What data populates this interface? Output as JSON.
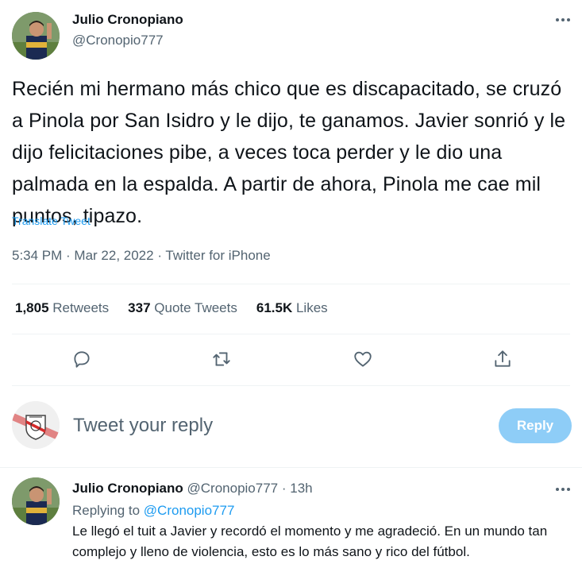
{
  "tweet": {
    "author_name": "Julio Cronopiano",
    "author_handle": "@Cronopio777",
    "text": "Recién mi hermano más chico que es discapacitado, se cruzó a Pinola por San Isidro y le dijo, te ganamos. Javier sonrió y le dijo felicitaciones pibe, a veces toca perder y le dio una palmada en la espalda. A partir de ahora, Pinola me cae mil puntos, tipazo.",
    "translate_label": "Translate Tweet",
    "time": "5:34 PM",
    "date": "Mar 22, 2022",
    "source": "Twitter for iPhone",
    "separator": " · "
  },
  "stats": {
    "retweets_count": "1,805",
    "retweets_label": "Retweets",
    "quotes_count": "337",
    "quotes_label": "Quote Tweets",
    "likes_count": "61.5K",
    "likes_label": "Likes"
  },
  "actions": [
    "reply-icon",
    "retweet-icon",
    "like-icon",
    "share-icon"
  ],
  "composer": {
    "placeholder": "Tweet your reply",
    "button_label": "Reply"
  },
  "reply": {
    "author_name": "Julio Cronopiano",
    "author_handle": "@Cronopio777",
    "age": "13h",
    "separator": " · ",
    "replying_to_label": "Replying to",
    "replying_to_handle": "@Cronopio777",
    "text": "Le llegó el tuit a Javier y recordó el momento y me agradeció. En un mundo tan complejo y lleno de violencia, esto es lo más sano y rico del fútbol."
  },
  "colors": {
    "accent": "#1d9bf0",
    "reply_button_disabled": "#8ecdf7",
    "secondary_text": "#536471"
  }
}
